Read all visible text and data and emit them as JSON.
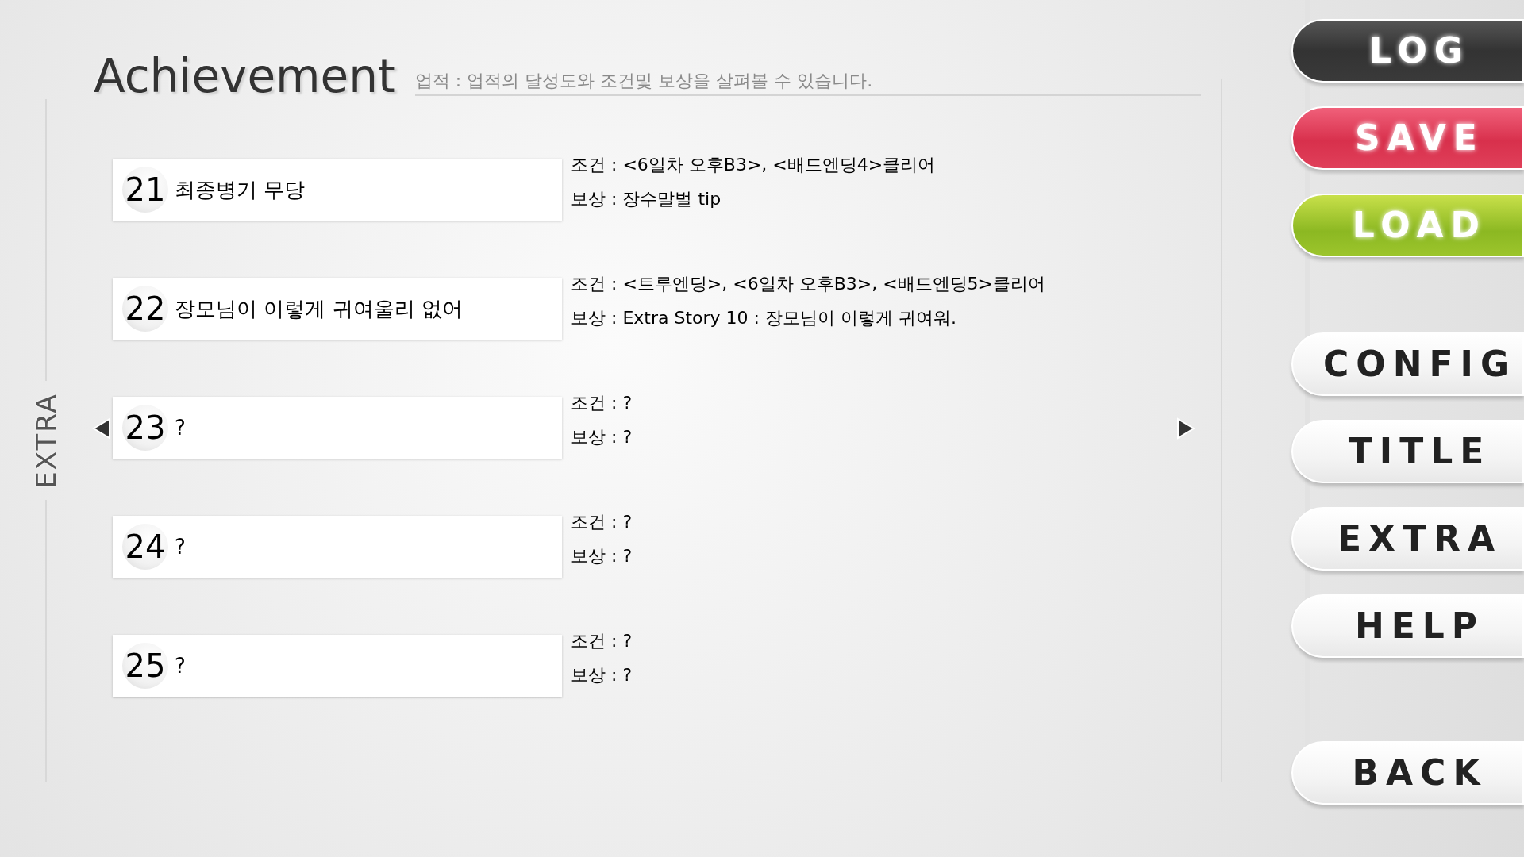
{
  "header": {
    "title": "Achievement",
    "subtitle": "업적 : 업적의 달성도와 조건및 보상을 살펴볼 수 있습니다."
  },
  "side_label": "EXTRA",
  "achievements": [
    {
      "number": "21",
      "name": "최종병기 무당",
      "condition": "조건 : <6일차 오후B3>, <배드엔딩4>클리어",
      "reward": "보상 : 장수말벌 tip"
    },
    {
      "number": "22",
      "name": "장모님이 이렇게 귀여울리 없어",
      "condition": "조건 : <트루엔딩>, <6일차 오후B3>, <배드엔딩5>클리어",
      "reward": "보상 : Extra Story 10 : 장모님이 이렇게 귀여워."
    },
    {
      "number": "23",
      "name": "?",
      "condition": "조건 : ?",
      "reward": "보상 : ?"
    },
    {
      "number": "24",
      "name": "?",
      "condition": "조건 : ?",
      "reward": "보상 : ?"
    },
    {
      "number": "25",
      "name": "?",
      "condition": "조건 : ?",
      "reward": "보상 : ?"
    }
  ],
  "menu": [
    {
      "label": "LOG",
      "kind": "dark"
    },
    {
      "label": "SAVE",
      "kind": "red"
    },
    {
      "label": "LOAD",
      "kind": "green"
    },
    {
      "label": "CONFIG",
      "kind": "plain"
    },
    {
      "label": "TITLE",
      "kind": "plain"
    },
    {
      "label": "EXTRA",
      "kind": "plain"
    },
    {
      "label": "HELP",
      "kind": "plain"
    },
    {
      "label": "BACK",
      "kind": "plain"
    }
  ]
}
